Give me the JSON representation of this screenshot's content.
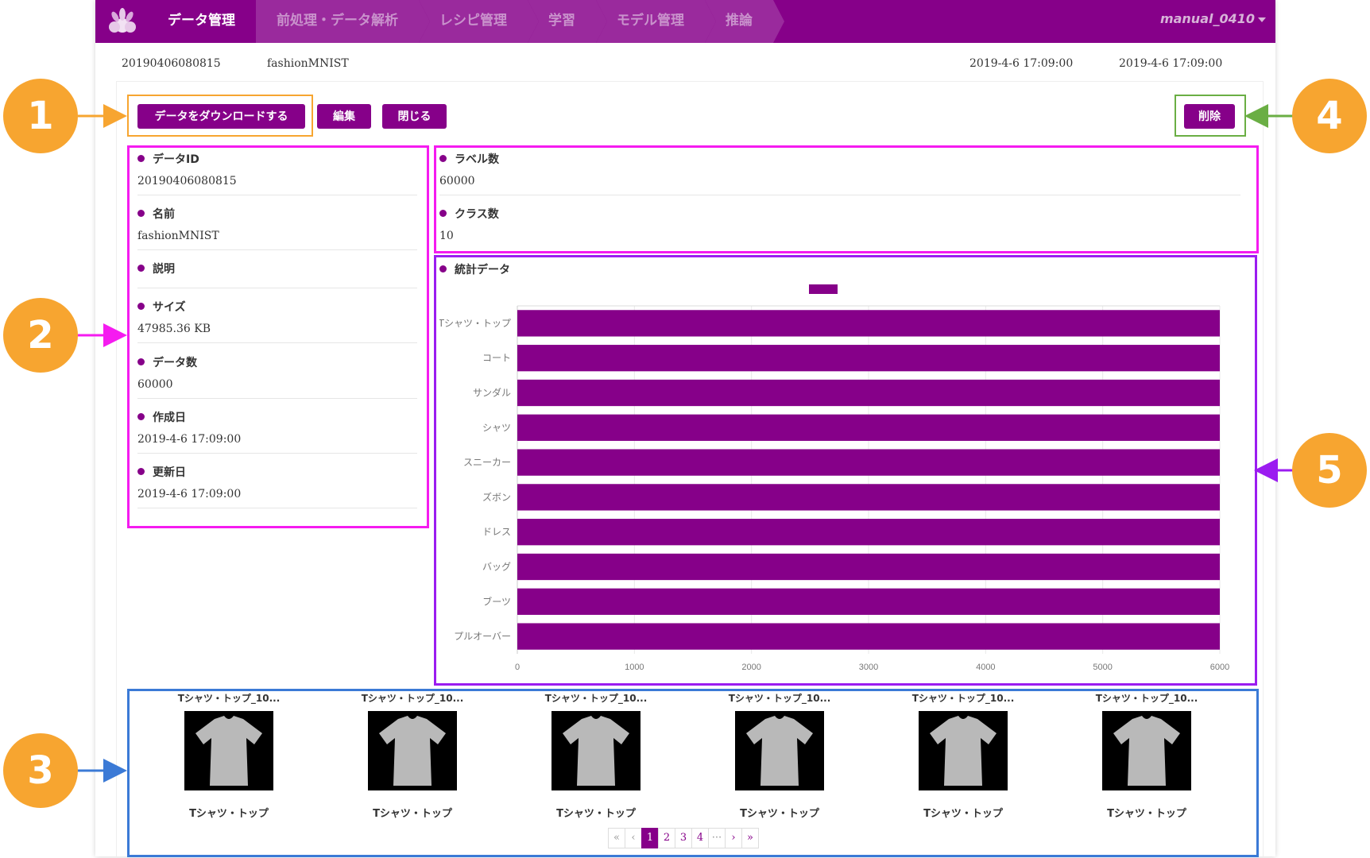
{
  "nav": {
    "crumbs": [
      "データ管理",
      "前処理・データ解析",
      "レシピ管理",
      "学習",
      "モデル管理",
      "推論"
    ],
    "user": "manual_0410"
  },
  "info": {
    "id": "20190406080815",
    "name": "fashionMNIST",
    "created": "2019-4-6 17:09:00",
    "updated": "2019-4-6 17:09:00"
  },
  "buttons": {
    "download": "データをダウンロードする",
    "edit": "編集",
    "close": "閉じる",
    "delete": "削除"
  },
  "fields": [
    {
      "label": "データID",
      "value": "20190406080815"
    },
    {
      "label": "名前",
      "value": "fashionMNIST"
    },
    {
      "label": "説明",
      "value": ""
    },
    {
      "label": "サイズ",
      "value": "47985.36 KB"
    },
    {
      "label": "データ数",
      "value": "60000"
    },
    {
      "label": "作成日",
      "value": "2019-4-6 17:09:00"
    },
    {
      "label": "更新日",
      "value": "2019-4-6 17:09:00"
    }
  ],
  "summary": [
    {
      "label": "ラベル数",
      "value": "60000"
    },
    {
      "label": "クラス数",
      "value": "10"
    }
  ],
  "stats_title": "統計データ",
  "chart_data": {
    "type": "bar",
    "orientation": "horizontal",
    "categories": [
      "Tシャツ・トップ",
      "コート",
      "サンダル",
      "シャツ",
      "スニーカー",
      "ズボン",
      "ドレス",
      "バッグ",
      "ブーツ",
      "プルオーバー"
    ],
    "values": [
      6000,
      6000,
      6000,
      6000,
      6000,
      6000,
      6000,
      6000,
      6000,
      6000
    ],
    "xlim": [
      0,
      6000
    ],
    "xticks": [
      0,
      1000,
      2000,
      3000,
      4000,
      5000,
      6000
    ],
    "color": "#860089",
    "legend": "top-center"
  },
  "thumbnails": [
    {
      "title": "Tシャツ・トップ_10...",
      "label": "Tシャツ・トップ"
    },
    {
      "title": "Tシャツ・トップ_10...",
      "label": "Tシャツ・トップ"
    },
    {
      "title": "Tシャツ・トップ_10...",
      "label": "Tシャツ・トップ"
    },
    {
      "title": "Tシャツ・トップ_10...",
      "label": "Tシャツ・トップ"
    },
    {
      "title": "Tシャツ・トップ_10...",
      "label": "Tシャツ・トップ"
    },
    {
      "title": "Tシャツ・トップ_10...",
      "label": "Tシャツ・トップ"
    }
  ],
  "pagination": [
    "«",
    "‹",
    "1",
    "2",
    "3",
    "4",
    "···",
    "›",
    "»"
  ],
  "pagination_current": "1",
  "callouts": [
    "1",
    "2",
    "3",
    "4",
    "5"
  ],
  "colors": {
    "brand": "#860089",
    "callout": "#f7a530"
  }
}
